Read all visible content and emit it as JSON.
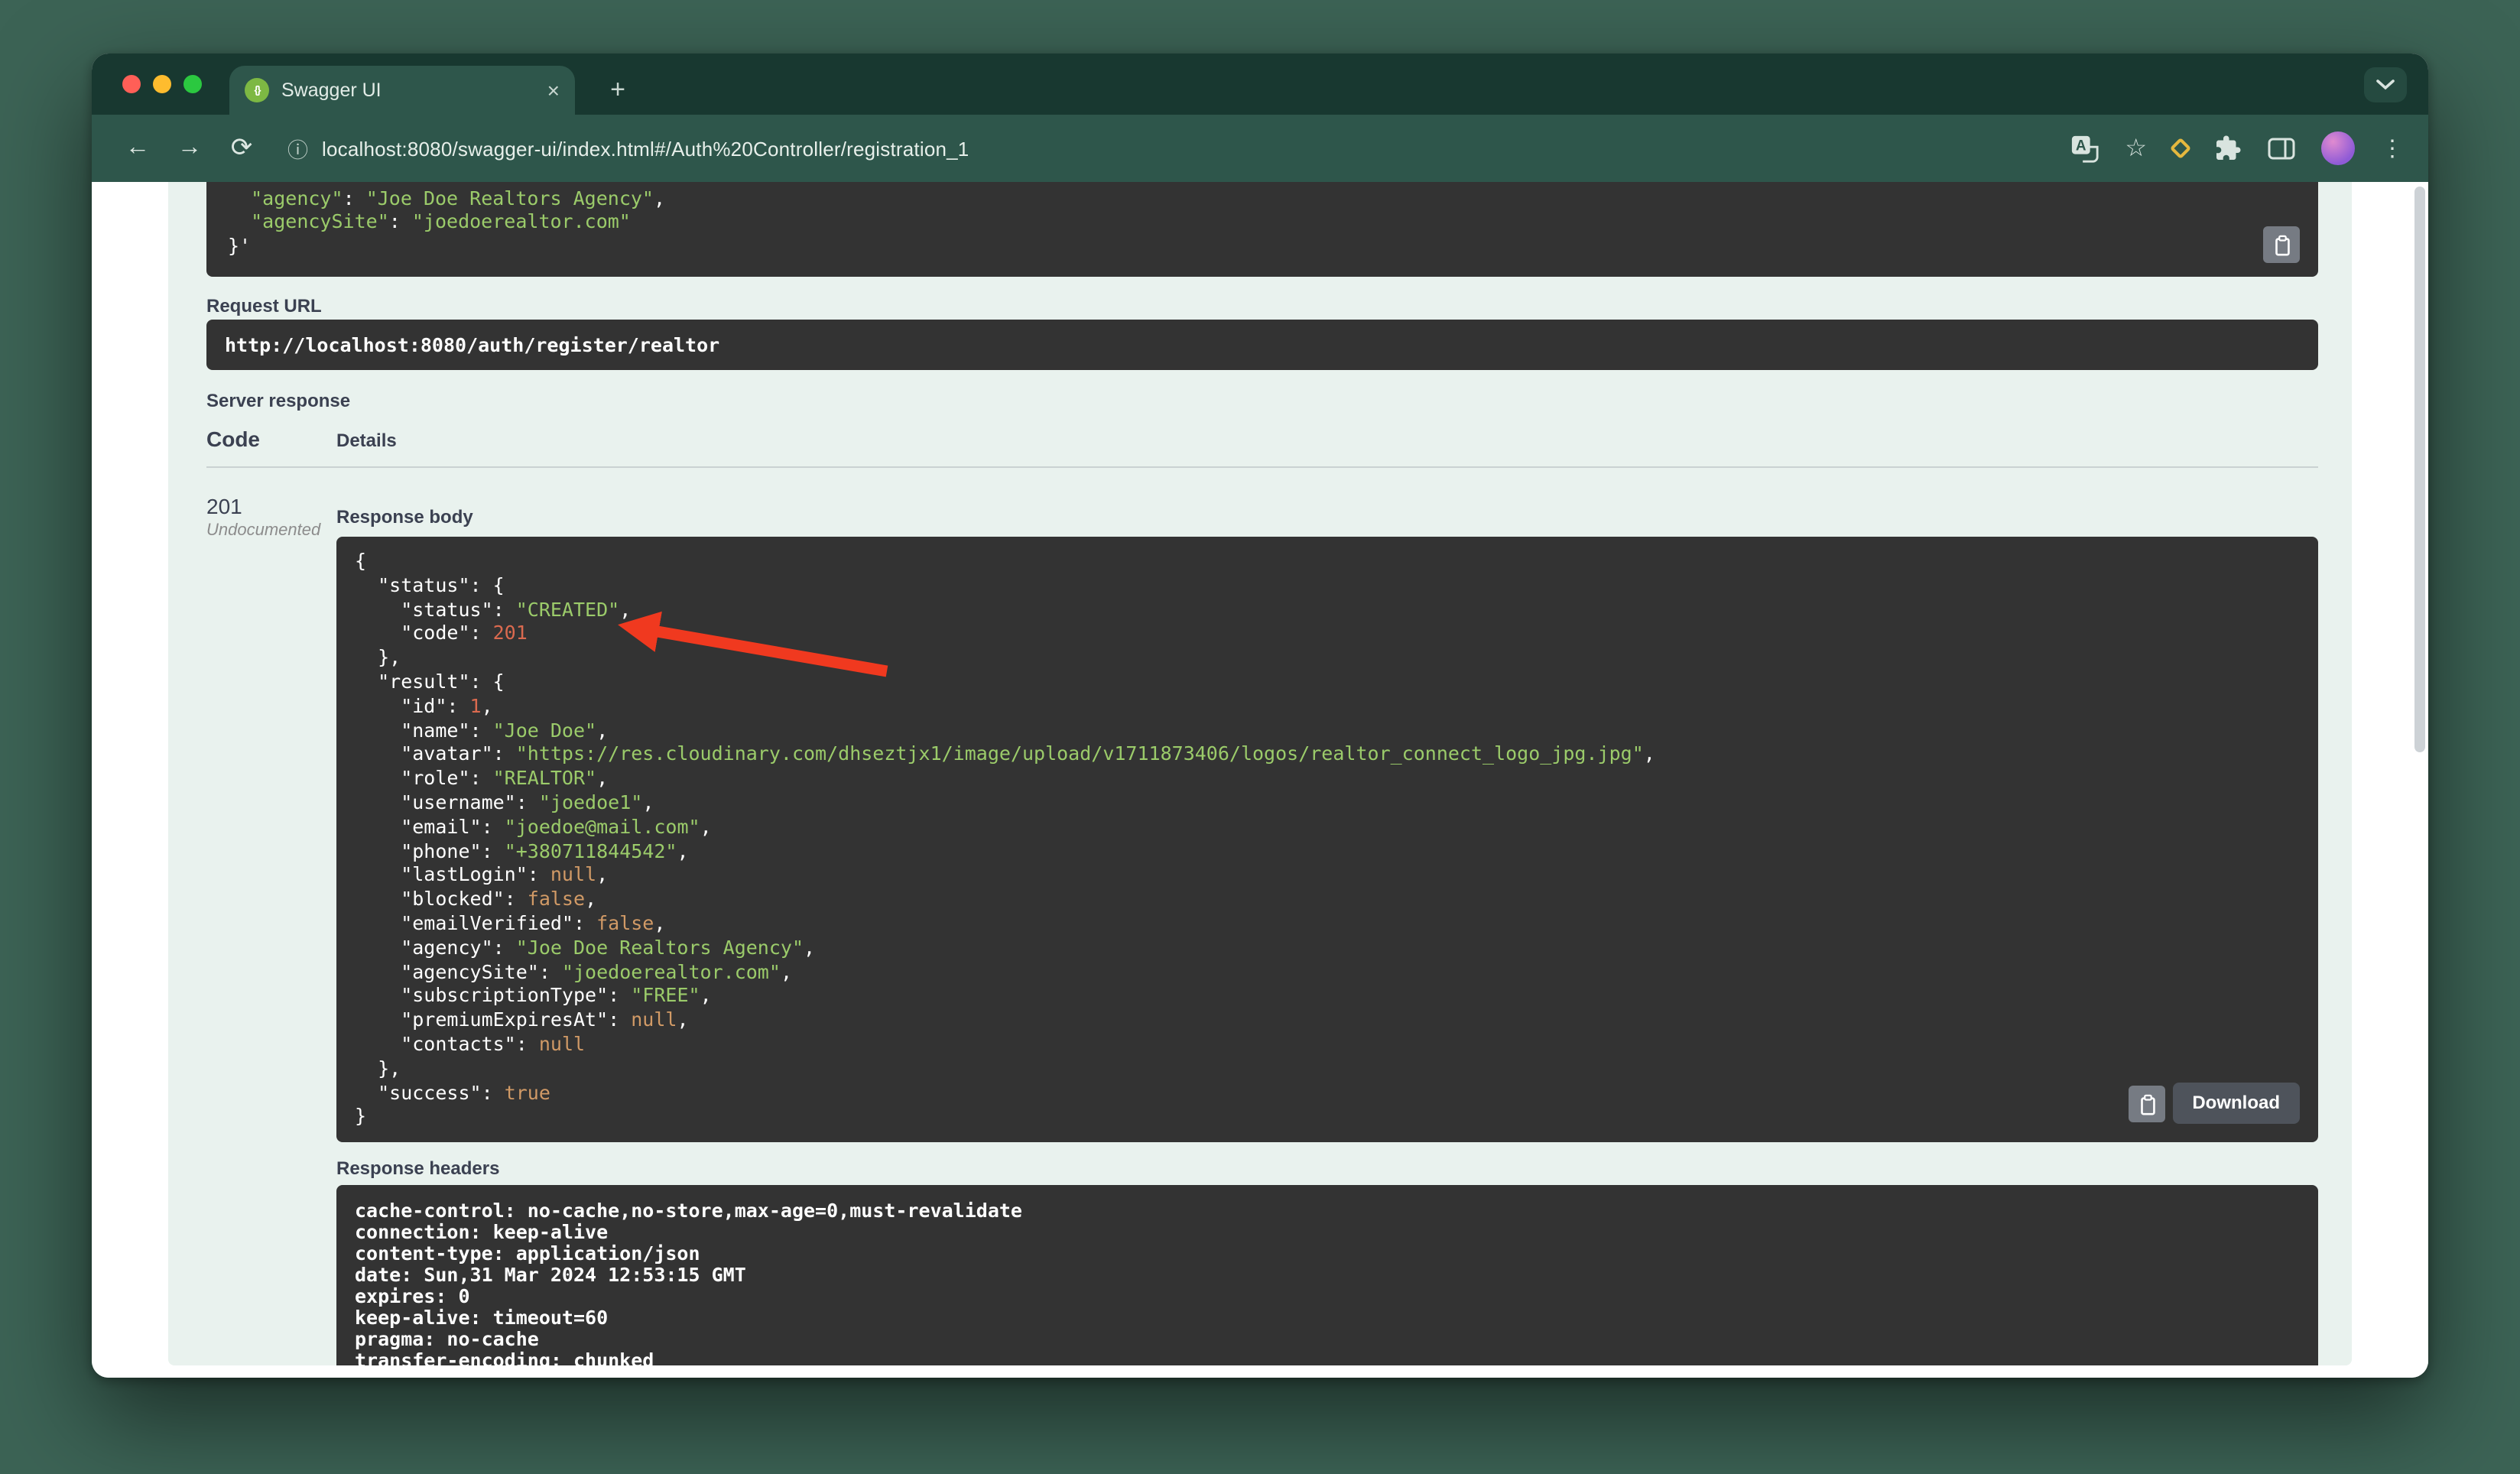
{
  "browser": {
    "tab_title": "Swagger UI",
    "url": "localhost:8080/swagger-ui/index.html#/Auth%20Controller/registration_1",
    "icons": {
      "back": "←",
      "forward": "→",
      "reload": "⟳",
      "site_info": "ⓘ",
      "bookmark_star": "☆",
      "menu_dots": "⋮",
      "tab_close": "×",
      "new_tab": "+",
      "favicon_glyph": "{}"
    }
  },
  "swagger": {
    "curl_block": {
      "lines": [
        [
          {
            "t": "  ",
            "c": "p"
          },
          {
            "t": "\"agency\"",
            "c": "s"
          },
          {
            "t": ": ",
            "c": "p"
          },
          {
            "t": "\"Joe Doe Realtors Agency\"",
            "c": "s"
          },
          {
            "t": ",",
            "c": "p"
          }
        ],
        [
          {
            "t": "  ",
            "c": "p"
          },
          {
            "t": "\"agencySite\"",
            "c": "s"
          },
          {
            "t": ": ",
            "c": "p"
          },
          {
            "t": "\"joedoerealtor.com\"",
            "c": "s"
          }
        ],
        [
          {
            "t": "}'",
            "c": "p"
          }
        ]
      ]
    },
    "request_url": {
      "label": "Request URL",
      "value": "http://localhost:8080/auth/register/realtor"
    },
    "server_response": {
      "label": "Server response",
      "code_header": "Code",
      "details_header": "Details",
      "status_code": "201",
      "status_note": "Undocumented"
    },
    "response_body": {
      "label": "Response body",
      "download_label": "Download",
      "lines": [
        [
          {
            "t": "{",
            "c": "p"
          }
        ],
        [
          {
            "t": "  \"status\": {",
            "c": "p"
          }
        ],
        [
          {
            "t": "    \"status\": ",
            "c": "p"
          },
          {
            "t": "\"CREATED\"",
            "c": "s"
          },
          {
            "t": ",",
            "c": "p"
          }
        ],
        [
          {
            "t": "    \"code\": ",
            "c": "p"
          },
          {
            "t": "201",
            "c": "num"
          }
        ],
        [
          {
            "t": "  },",
            "c": "p"
          }
        ],
        [
          {
            "t": "  \"result\": {",
            "c": "p"
          }
        ],
        [
          {
            "t": "    \"id\": ",
            "c": "p"
          },
          {
            "t": "1",
            "c": "num"
          },
          {
            "t": ",",
            "c": "p"
          }
        ],
        [
          {
            "t": "    \"name\": ",
            "c": "p"
          },
          {
            "t": "\"Joe Doe\"",
            "c": "s"
          },
          {
            "t": ",",
            "c": "p"
          }
        ],
        [
          {
            "t": "    \"avatar\": ",
            "c": "p"
          },
          {
            "t": "\"https://res.cloudinary.com/dhseztjx1/image/upload/v1711873406/logos/realtor_connect_logo_jpg.jpg\"",
            "c": "s"
          },
          {
            "t": ",",
            "c": "p"
          }
        ],
        [
          {
            "t": "    \"role\": ",
            "c": "p"
          },
          {
            "t": "\"REALTOR\"",
            "c": "s"
          },
          {
            "t": ",",
            "c": "p"
          }
        ],
        [
          {
            "t": "    \"username\": ",
            "c": "p"
          },
          {
            "t": "\"joedoe1\"",
            "c": "s"
          },
          {
            "t": ",",
            "c": "p"
          }
        ],
        [
          {
            "t": "    \"email\": ",
            "c": "p"
          },
          {
            "t": "\"joedoe@mail.com\"",
            "c": "s"
          },
          {
            "t": ",",
            "c": "p"
          }
        ],
        [
          {
            "t": "    \"phone\": ",
            "c": "p"
          },
          {
            "t": "\"+380711844542\"",
            "c": "s"
          },
          {
            "t": ",",
            "c": "p"
          }
        ],
        [
          {
            "t": "    \"lastLogin\": ",
            "c": "p"
          },
          {
            "t": "null",
            "c": "lit"
          },
          {
            "t": ",",
            "c": "p"
          }
        ],
        [
          {
            "t": "    \"blocked\": ",
            "c": "p"
          },
          {
            "t": "false",
            "c": "lit"
          },
          {
            "t": ",",
            "c": "p"
          }
        ],
        [
          {
            "t": "    \"emailVerified\": ",
            "c": "p"
          },
          {
            "t": "false",
            "c": "lit"
          },
          {
            "t": ",",
            "c": "p"
          }
        ],
        [
          {
            "t": "    \"agency\": ",
            "c": "p"
          },
          {
            "t": "\"Joe Doe Realtors Agency\"",
            "c": "s"
          },
          {
            "t": ",",
            "c": "p"
          }
        ],
        [
          {
            "t": "    \"agencySite\": ",
            "c": "p"
          },
          {
            "t": "\"joedoerealtor.com\"",
            "c": "s"
          },
          {
            "t": ",",
            "c": "p"
          }
        ],
        [
          {
            "t": "    \"subscriptionType\": ",
            "c": "p"
          },
          {
            "t": "\"FREE\"",
            "c": "s"
          },
          {
            "t": ",",
            "c": "p"
          }
        ],
        [
          {
            "t": "    \"premiumExpiresAt\": ",
            "c": "p"
          },
          {
            "t": "null",
            "c": "lit"
          },
          {
            "t": ",",
            "c": "p"
          }
        ],
        [
          {
            "t": "    \"contacts\": ",
            "c": "p"
          },
          {
            "t": "null",
            "c": "lit"
          }
        ],
        [
          {
            "t": "  },",
            "c": "p"
          }
        ],
        [
          {
            "t": "  \"success\": ",
            "c": "p"
          },
          {
            "t": "true",
            "c": "lit"
          }
        ],
        [
          {
            "t": "}",
            "c": "p"
          }
        ]
      ]
    },
    "response_headers": {
      "label": "Response headers",
      "lines": [
        "cache-control: no-cache,no-store,max-age=0,must-revalidate",
        "connection: keep-alive",
        "content-type: application/json",
        "date: Sun,31 Mar 2024 12:53:15 GMT",
        "expires: 0",
        "keep-alive: timeout=60",
        "pragma: no-cache",
        "transfer-encoding: chunked"
      ]
    }
  },
  "colors": {
    "string_green": "#9BCB6A",
    "number_red": "#DB6A4F",
    "literal_orange": "#D19A66",
    "arrow_red": "#F0391F",
    "traffic_red": "#FF5F57",
    "traffic_yellow": "#FEBC2E",
    "traffic_green": "#2BC840",
    "opblock_green_bg": "#E9F2EE",
    "code_block_bg": "#333333"
  }
}
